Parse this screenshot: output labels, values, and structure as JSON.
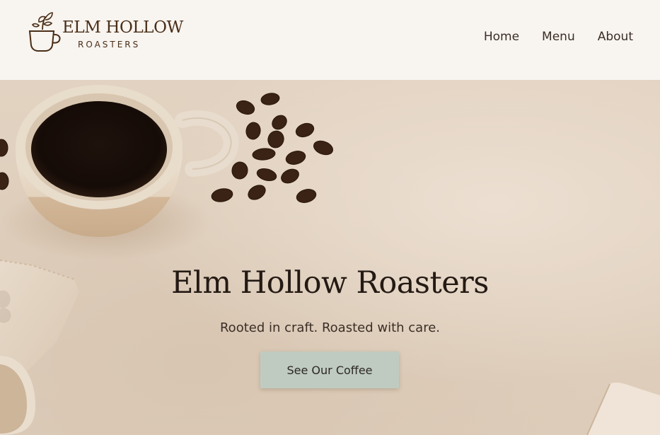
{
  "brand": {
    "name_line1": "ELM HOLLOW",
    "name_line2": "ROASTERS",
    "logo_icon": "coffee-cup-sprout-icon"
  },
  "nav": {
    "items": [
      {
        "label": "Home"
      },
      {
        "label": "Menu"
      },
      {
        "label": "About"
      }
    ]
  },
  "hero": {
    "title": "Elm Hollow Roasters",
    "subtitle": "Rooted in craft. Roasted with care.",
    "cta_label": "See Our Coffee"
  },
  "colors": {
    "header_bg": "#f8f4f0",
    "brand_brown": "#4a2e16",
    "cta_bg": "#bfcbc0",
    "hero_bg": "#e2d2c1"
  }
}
